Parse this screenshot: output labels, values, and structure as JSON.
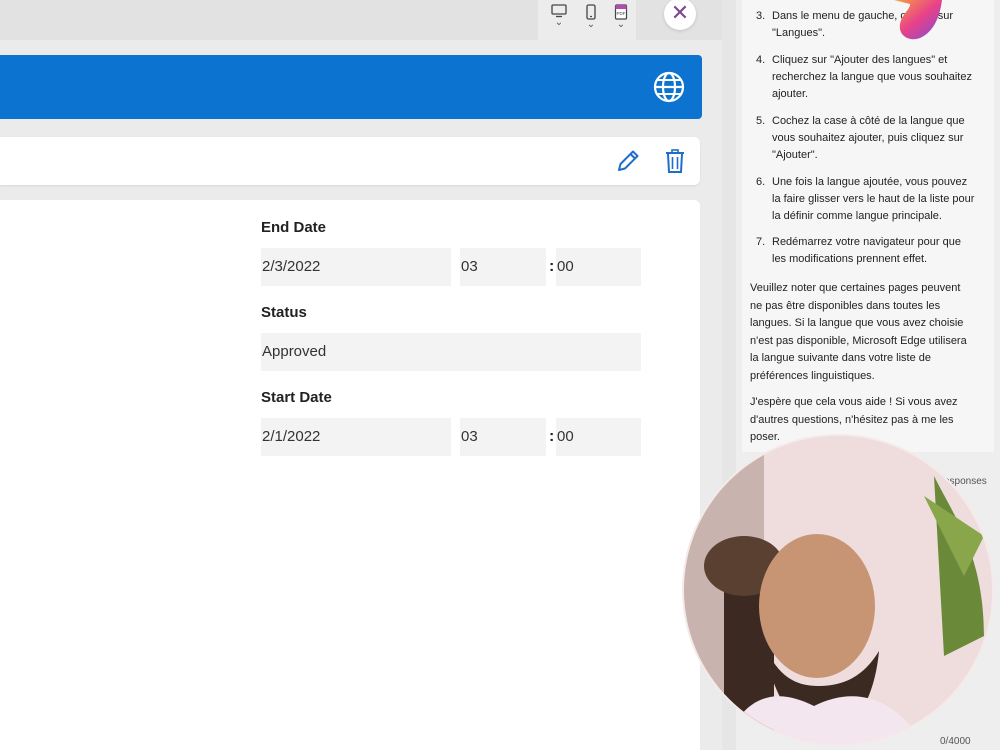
{
  "browser": {
    "device_icons": [
      "desktop-icon",
      "phone-icon",
      "pdf-icon"
    ],
    "pdf_label": "PDF",
    "close_glyph": "✕"
  },
  "header": {
    "color": "#0d73d0",
    "icon": "globe-icon"
  },
  "command_bar": {
    "icons": [
      "edit-icon",
      "delete-icon"
    ]
  },
  "form": {
    "end_date": {
      "label": "End Date",
      "date": "2/3/2022",
      "hour": "03",
      "minute": "00"
    },
    "status": {
      "label": "Status",
      "value": "Approved"
    },
    "start_date": {
      "label": "Start Date",
      "date": "2/1/2022",
      "hour": "03",
      "minute": "00"
    },
    "time_separator": ":"
  },
  "chat": {
    "steps": [
      {
        "num": "3.",
        "lines": [
          "Dans le menu de gauche, cliquez sur",
          "\"Langues\"."
        ]
      },
      {
        "num": "4.",
        "lines": [
          "Cliquez sur \"Ajouter des langues\" et",
          "recherchez la langue que vous souhaitez",
          "ajouter."
        ]
      },
      {
        "num": "5.",
        "lines": [
          "Cochez la case à côté de la langue que",
          "vous souhaitez ajouter, puis cliquez sur",
          "\"Ajouter\"."
        ]
      },
      {
        "num": "6.",
        "lines": [
          "Une fois la langue ajoutée, vous pouvez",
          "la faire glisser vers le haut de la liste pour",
          "la définir comme langue principale."
        ]
      },
      {
        "num": "7.",
        "lines": [
          "Redémarrez votre navigateur pour que",
          "les modifications prennent effet."
        ]
      }
    ],
    "note": [
      "Veuillez noter que certaines pages peuvent",
      "ne pas être disponibles dans toutes les",
      "langues. Si la langue que vous avez choisie",
      "n'est pas disponible, Microsoft Edge utilisera",
      "la langue suivante dans votre liste de",
      "préférences linguistiques."
    ],
    "closing": [
      "J'espère que cela vous aide ! Si vous avez",
      "d'autres questions, n'hésitez pas à me les",
      "poser."
    ],
    "responses_label": "esponses",
    "char_counter": "0/4000",
    "accent": "#5b2d8e"
  }
}
